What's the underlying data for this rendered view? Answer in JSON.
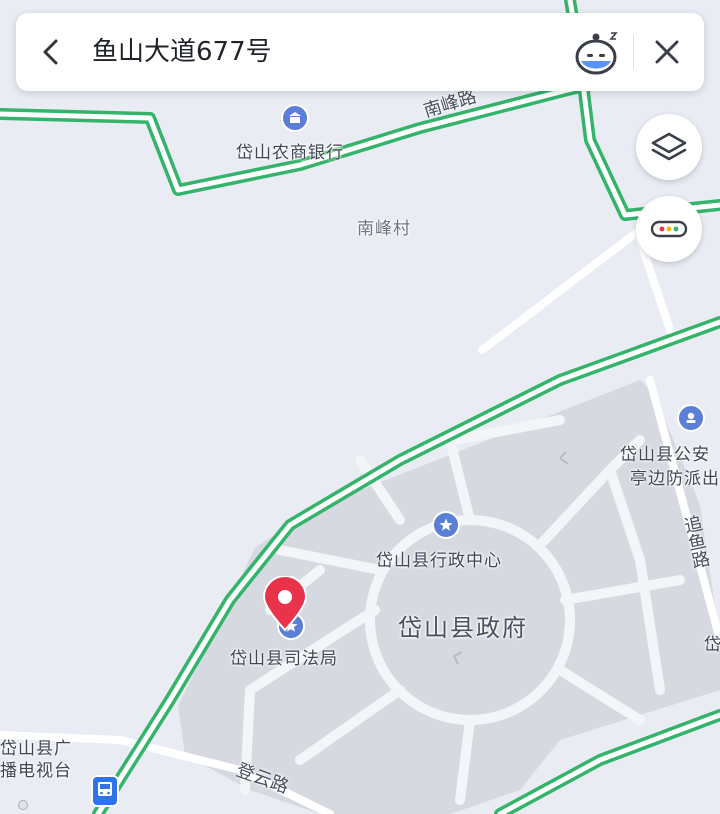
{
  "search": {
    "query": "鱼山大道677号"
  },
  "icons": {
    "back": "chevron-left-icon",
    "voice": "voice-assistant-icon",
    "close": "close-icon",
    "layers": "layers-icon",
    "more": "more-dots-icon",
    "pin": "location-pin-icon",
    "bus": "bus-stop-icon"
  },
  "colors": {
    "road_green": "#34b36a",
    "pin_red": "#e8334a",
    "poi_blue": "#5b7fd6",
    "map_bg": "#e9ecf3",
    "block_grey": "#d6d9df"
  },
  "map": {
    "roads": {
      "nanfeng": "南峰路",
      "zhuiyu": "追鱼路",
      "dengyun": "登云路"
    },
    "places": {
      "bank": "岱山农商银行",
      "village": "南峰村",
      "police": "岱山县公安",
      "police2": "亭边防派出",
      "admin_center": "岱山县行政中心",
      "gov": "岱山县政府",
      "justice": "岱山县司法局",
      "tv1": "岱山县广",
      "tv2": "播电视台",
      "edge_right": "岱"
    }
  }
}
